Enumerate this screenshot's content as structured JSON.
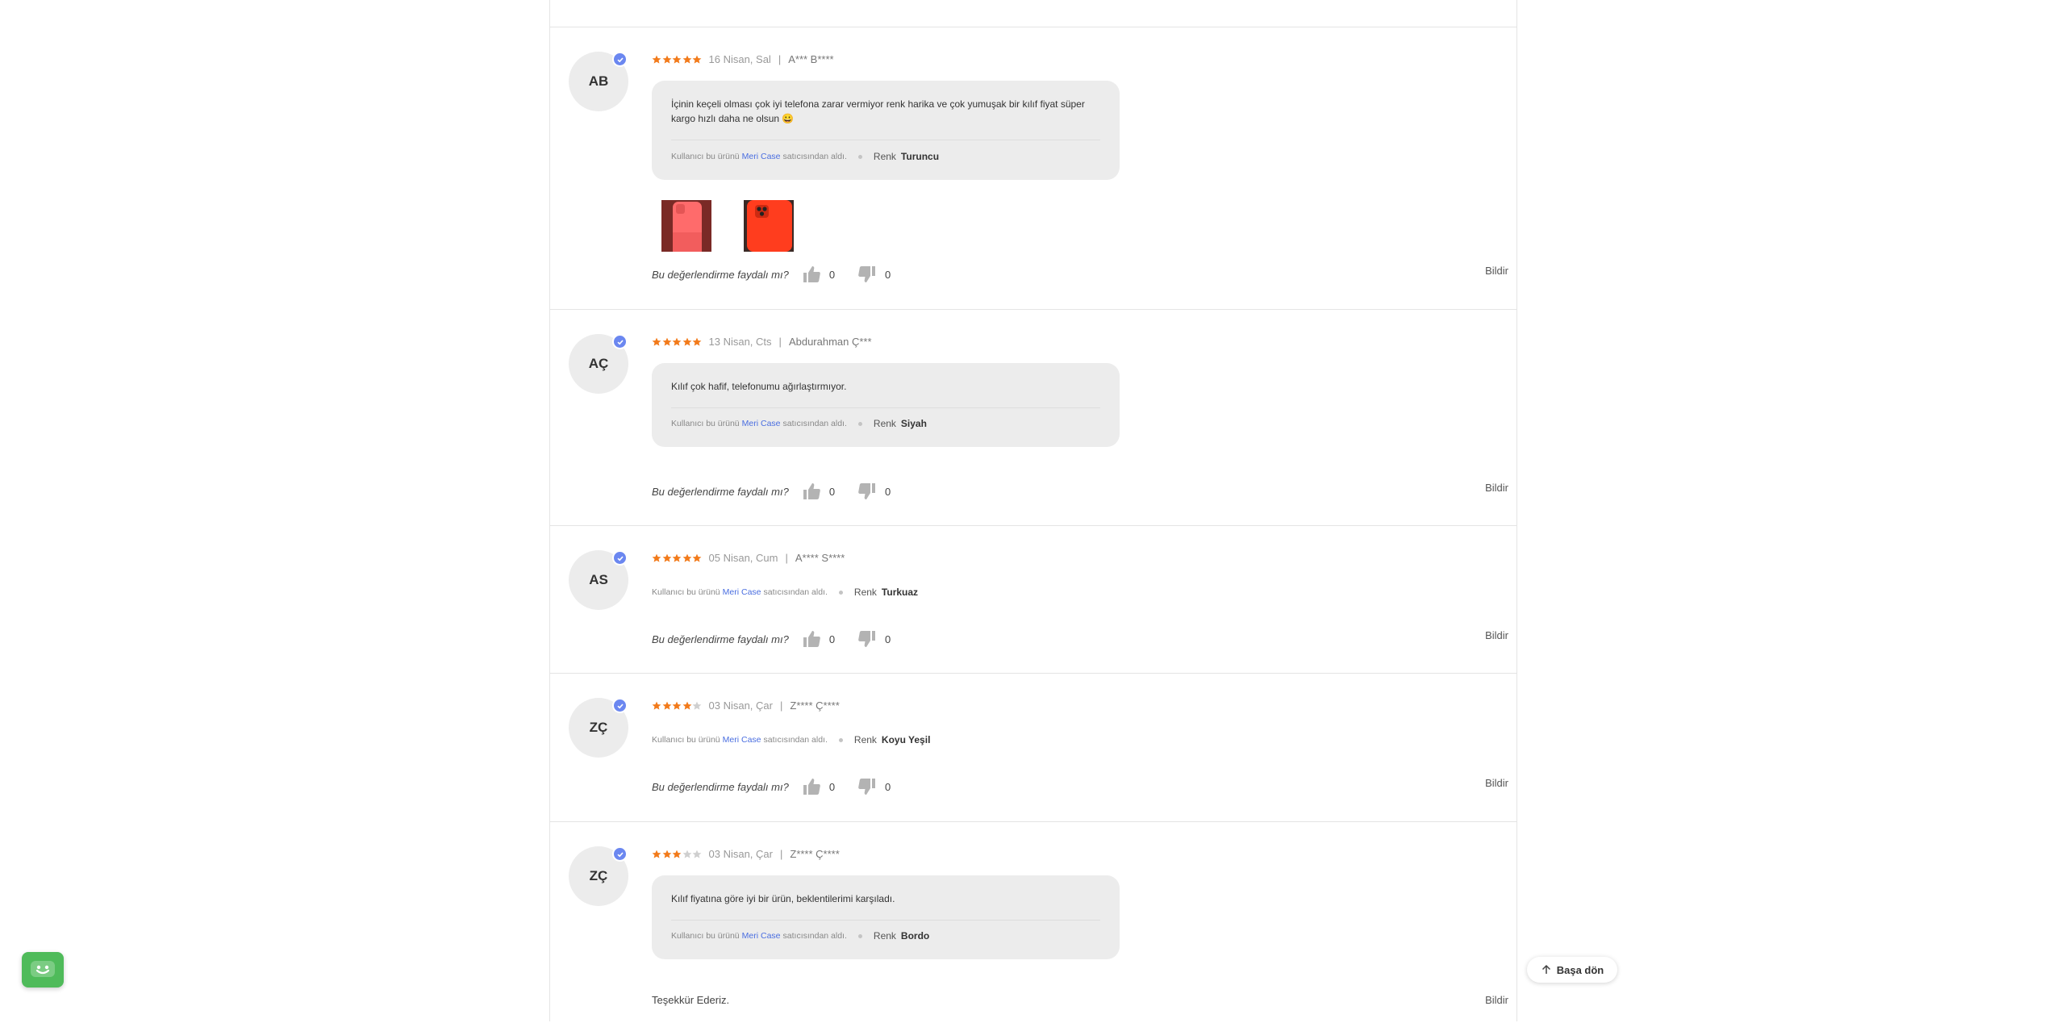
{
  "reviews": [
    {
      "initials": "AB",
      "rating": 5,
      "date": "16 Nisan, Sal",
      "author": "A*** B****",
      "comment": "İçinin keçeli olması çok iyi telefona zarar vermiyor renk harika ve çok yumuşak bir kılıf fiyat süper kargo hızlı daha ne olsun 😀",
      "seller_prefix": "Kullanıcı bu ürünü",
      "seller_name": "Meri Case",
      "seller_suffix": "satıcısından aldı.",
      "attr_label": "Renk",
      "attr_value": "Turuncu",
      "helpful_question": "Bu değerlendirme faydalı mı?",
      "likes": "0",
      "dislikes": "0",
      "report": "Bildir"
    },
    {
      "initials": "AÇ",
      "rating": 5,
      "date": "13 Nisan, Cts",
      "author": "Abdurahman Ç***",
      "comment": "Kılıf çok hafif, telefonumu ağırlaştırmıyor.",
      "seller_prefix": "Kullanıcı bu ürünü",
      "seller_name": "Meri Case",
      "seller_suffix": "satıcısından aldı.",
      "attr_label": "Renk",
      "attr_value": "Siyah",
      "helpful_question": "Bu değerlendirme faydalı mı?",
      "likes": "0",
      "dislikes": "0",
      "report": "Bildir"
    },
    {
      "initials": "AS",
      "rating": 5,
      "date": "05 Nisan, Cum",
      "author": "A**** S****",
      "seller_prefix": "Kullanıcı bu ürünü",
      "seller_name": "Meri Case",
      "seller_suffix": "satıcısından aldı.",
      "attr_label": "Renk",
      "attr_value": "Turkuaz",
      "helpful_question": "Bu değerlendirme faydalı mı?",
      "likes": "0",
      "dislikes": "0",
      "report": "Bildir"
    },
    {
      "initials": "ZÇ",
      "rating": 4,
      "date": "03 Nisan, Çar",
      "author": "Z**** Ç****",
      "seller_prefix": "Kullanıcı bu ürünü",
      "seller_name": "Meri Case",
      "seller_suffix": "satıcısından aldı.",
      "attr_label": "Renk",
      "attr_value": "Koyu Yeşil",
      "helpful_question": "Bu değerlendirme faydalı mı?",
      "likes": "0",
      "dislikes": "0",
      "report": "Bildir"
    },
    {
      "initials": "ZÇ",
      "rating": 3,
      "date": "03 Nisan, Çar",
      "author": "Z**** Ç****",
      "comment": "Kılıf fiyatına göre iyi bir ürün, beklentilerimi karşıladı.",
      "seller_prefix": "Kullanıcı bu ürünü",
      "seller_name": "Meri Case",
      "seller_suffix": "satıcısından aldı.",
      "attr_label": "Renk",
      "attr_value": "Bordo",
      "seller_reply": "Teşekkür Ederiz.",
      "report": "Bildir"
    }
  ],
  "back_to_top": "Başa dön",
  "icons": {
    "star": "star-icon",
    "thumbs_up": "thumbs-up-icon",
    "thumbs_down": "thumbs-down-icon",
    "verified": "verified-check-icon",
    "back_to_top": "arrow-up-icon",
    "chat": "chatbot-icon"
  },
  "colors": {
    "star_filled": "#f27a1a",
    "star_empty": "#cfcfcf",
    "seller_link": "#4a6ee0",
    "verified_badge": "#6b87f0",
    "chatbot": "#4fbb5a"
  }
}
